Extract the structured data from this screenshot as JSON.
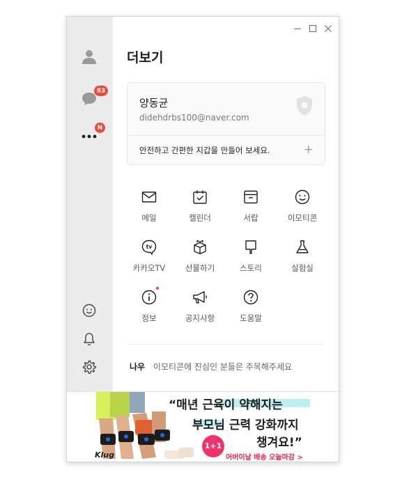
{
  "panel": {
    "title": "더보기"
  },
  "sidebar": {
    "chats_badge": "83",
    "more_badge": "N"
  },
  "profile": {
    "name": "양동균",
    "email": "didehdrbs100@naver.com",
    "wallet_prompt": "안전하고 간편한 지갑을 만들어 보세요."
  },
  "menu": {
    "items": [
      {
        "label": "메일",
        "icon": "mail-icon"
      },
      {
        "label": "캘린더",
        "icon": "calendar-icon"
      },
      {
        "label": "서랍",
        "icon": "drawer-icon"
      },
      {
        "label": "이모티콘",
        "icon": "emoticon-icon"
      },
      {
        "label": "카카오TV",
        "icon": "tv-icon"
      },
      {
        "label": "선물하기",
        "icon": "gift-icon"
      },
      {
        "label": "스토리",
        "icon": "story-icon"
      },
      {
        "label": "실험실",
        "icon": "flask-icon"
      },
      {
        "label": "정보",
        "icon": "info-icon"
      },
      {
        "label": "공지사항",
        "icon": "megaphone-icon"
      },
      {
        "label": "도움말",
        "icon": "help-icon"
      }
    ]
  },
  "status": {
    "name": "나우",
    "message": "이모티콘에 진심인 분들은 주목해주세요"
  },
  "ad": {
    "brand": "Klug",
    "headline_line1": "“매년 근육이 약해지는",
    "headline_line2": "부모님 근력 강화까지",
    "headline_line3": "챙겨요!”",
    "bundle": "1+1",
    "subtext": "어버이날 배송 오늘마감 >"
  },
  "colors": {
    "badge": "#f0473b",
    "sidebar_bg": "#ececec",
    "ad_highlight": "#bfeef0"
  }
}
